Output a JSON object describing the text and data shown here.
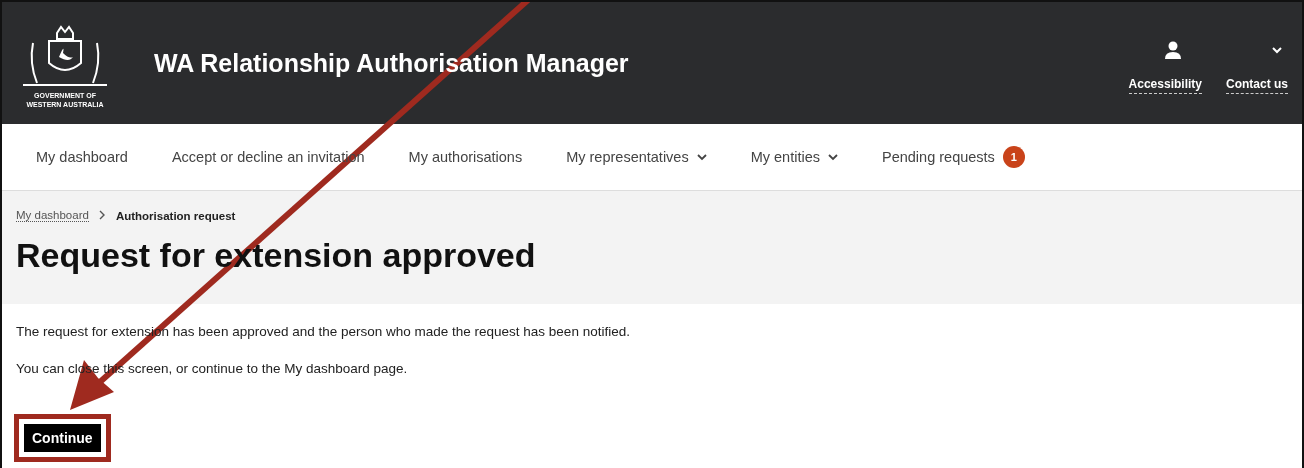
{
  "header": {
    "logo_lines": [
      "GOVERNMENT OF",
      "WESTERN AUSTRALIA"
    ],
    "title": "WA Relationship Authorisation Manager",
    "links": [
      "Accessibility",
      "Contact us"
    ]
  },
  "nav": [
    {
      "label": "My dashboard",
      "dropdown": false
    },
    {
      "label": "Accept or decline an invitation",
      "dropdown": false
    },
    {
      "label": "My authorisations",
      "dropdown": false
    },
    {
      "label": "My representatives",
      "dropdown": true
    },
    {
      "label": "My entities",
      "dropdown": true
    },
    {
      "label": "Pending requests",
      "dropdown": false,
      "badge": "1"
    }
  ],
  "breadcrumb": [
    {
      "label": "My dashboard",
      "kind": "link"
    },
    {
      "label": "Authorisation request",
      "kind": "current"
    }
  ],
  "heading": "Request for extension approved",
  "paragraphs": [
    "The request for extension has been approved and the person who made the request has been notified.",
    "You can close this screen, or continue to the My dashboard page."
  ],
  "button": {
    "label": "Continue",
    "highlighted": true
  }
}
